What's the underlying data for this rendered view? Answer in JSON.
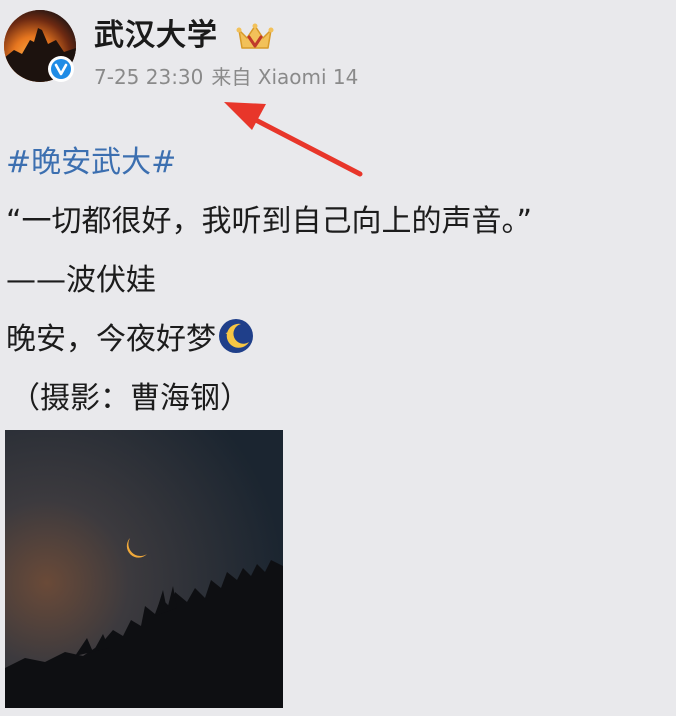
{
  "header": {
    "account_name": "武汉大学",
    "timestamp": "7-25 23:30",
    "source": "来自 Xiaomi 14"
  },
  "post": {
    "hashtag": "#晚安武大#",
    "quote": "“一切都很好，我听到自己向上的声音。”",
    "attribution": "——波伏娃",
    "goodnight": "晚安，今夜好梦",
    "photo_credit": "（摄影：曹海钢）",
    "emoji": "moon-stars-emoji"
  },
  "icons": {
    "verified": "verified-icon",
    "member_badge": "crown-badge-icon",
    "annotation": "red-arrow-icon"
  },
  "colors": {
    "background": "#e9e9ec",
    "hashtag": "#3c6fb0",
    "meta_text": "#8a8a8a",
    "verified_blue": "#1f8ce6",
    "arrow_red": "#e8362a"
  }
}
